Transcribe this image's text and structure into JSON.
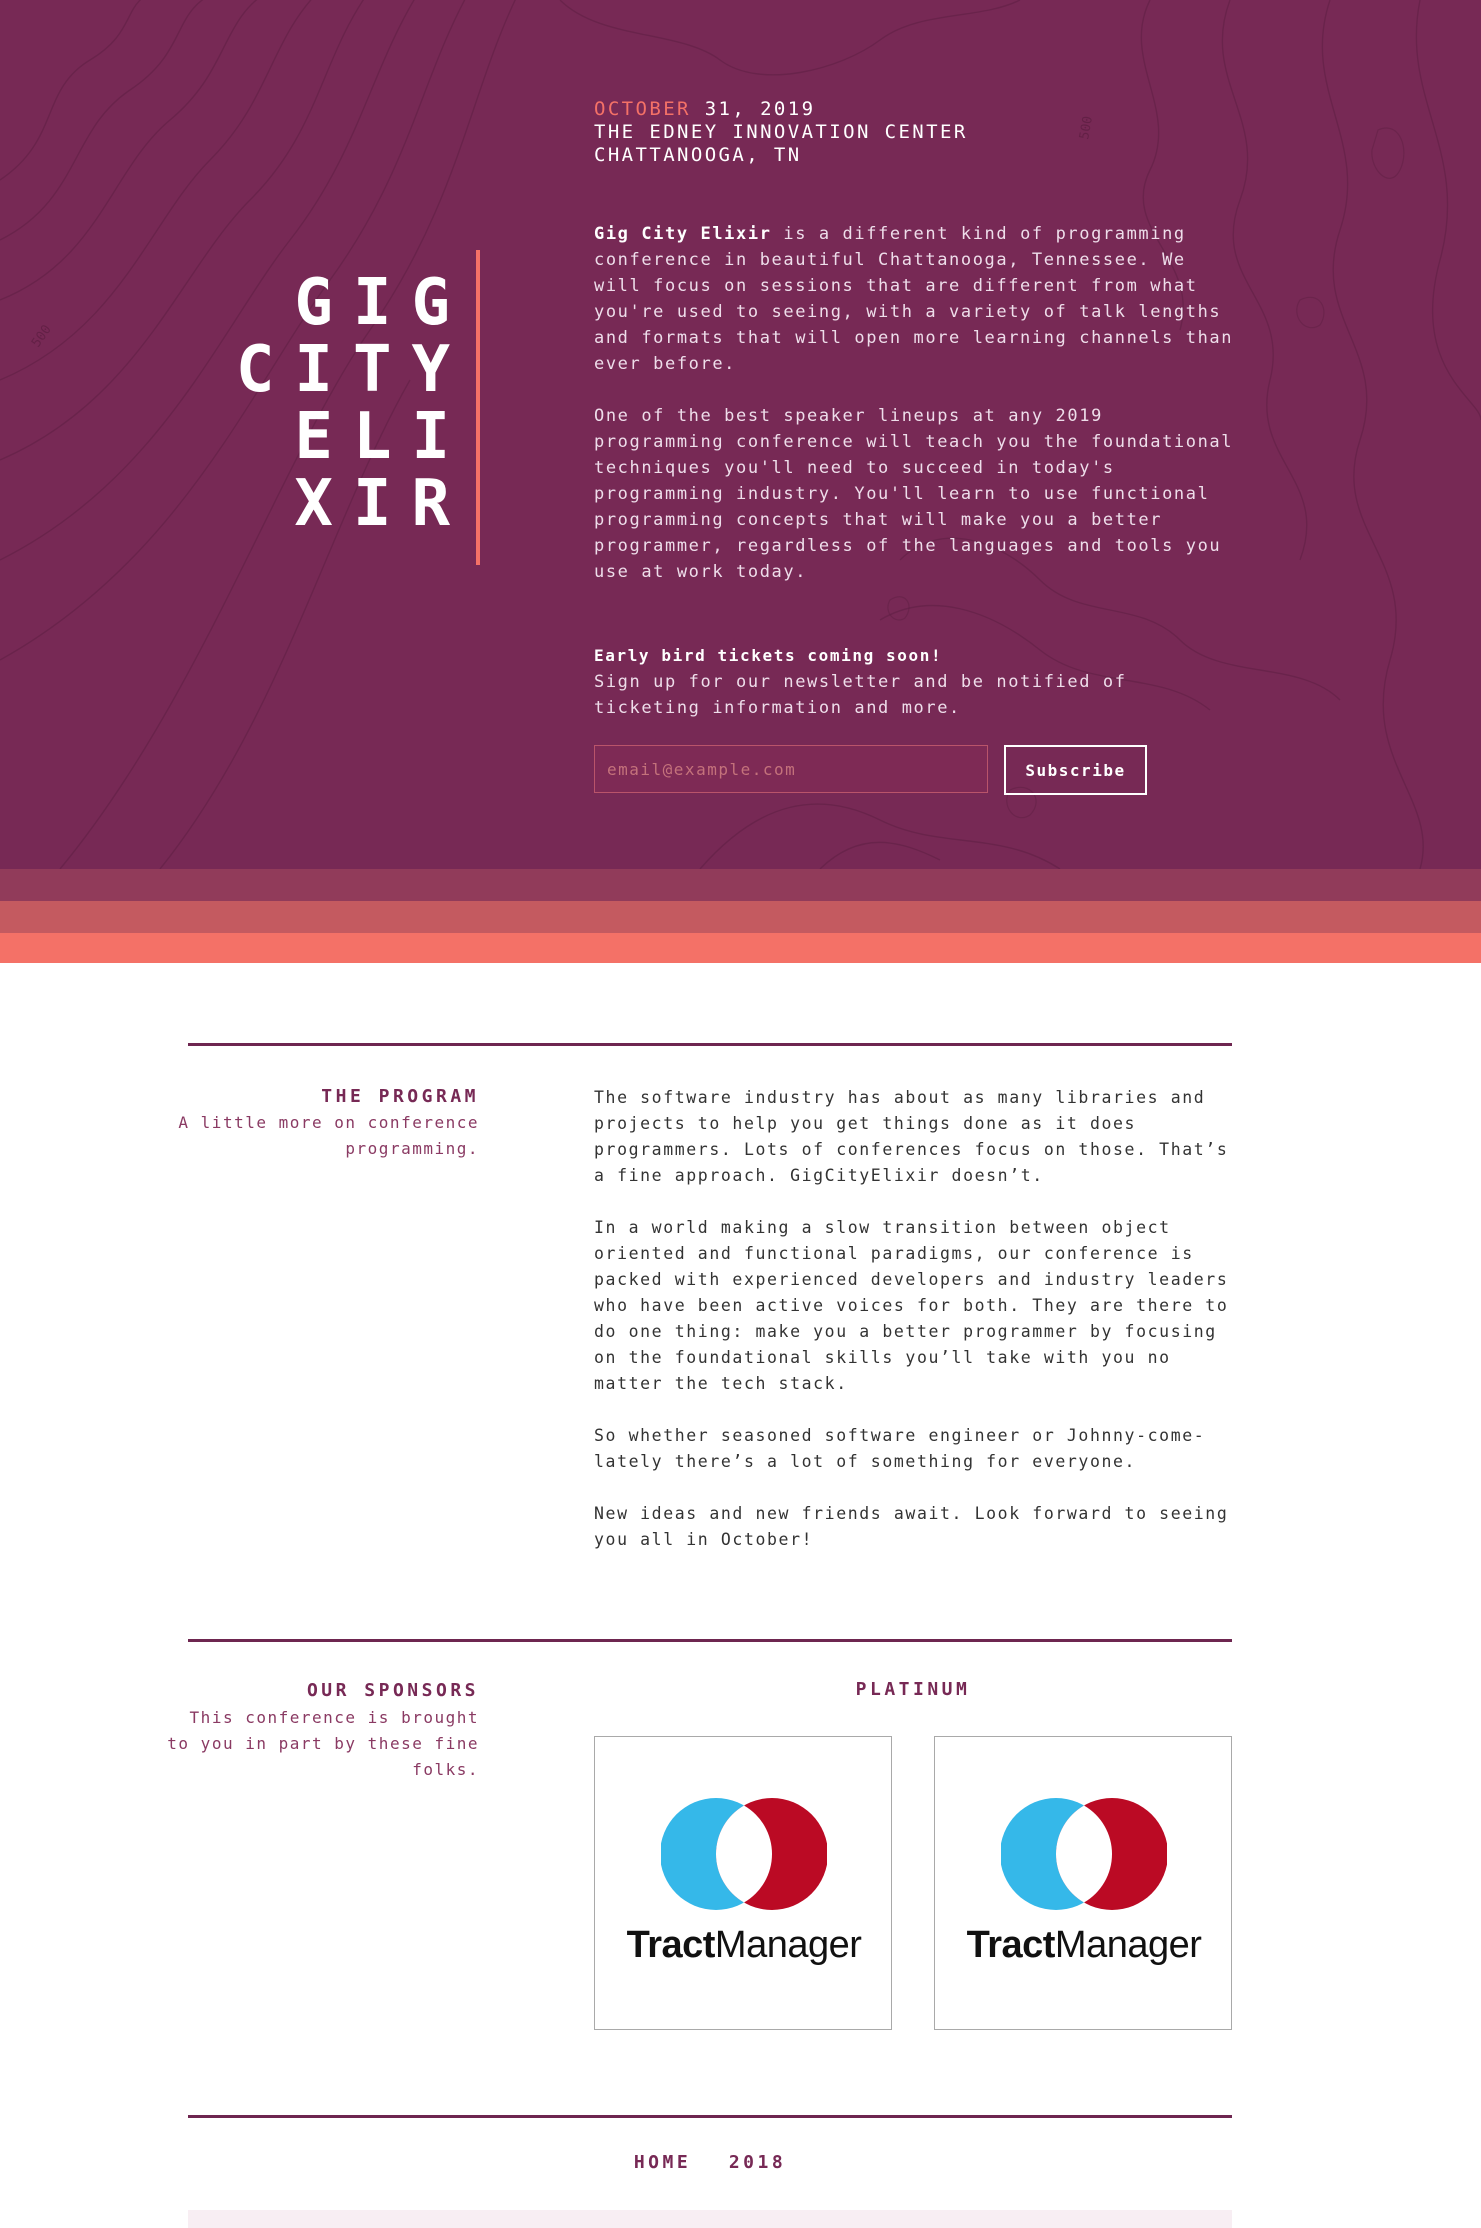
{
  "hero": {
    "logo_lines": [
      "GIG",
      "CITY",
      "ELI",
      "XIR"
    ],
    "date_month": "OCTOBER",
    "date_rest": " 31, 2019",
    "venue_line1": "THE EDNEY INNOVATION CENTER",
    "venue_line2": "CHATTANOOGA, TN",
    "intro_name": "Gig City Elixir",
    "intro_rest": " is a different kind of programming conference in beautiful Chattanooga, Tennessee. We will focus on sessions that are different from what you're used to seeing, with a variety of talk lengths and formats that will open more learning channels than ever before.",
    "para2": "One of the best speaker lineups at any 2019 programming conference will teach you the foundational techniques you'll need to succeed in today's programming industry. You'll learn to use functional programming concepts that will make you a better programmer, regardless of the languages and tools you use at work today.",
    "early_bird": "Early bird tickets coming soon!",
    "signup_text": "Sign up for our newsletter and be notified of ticketing information and more.",
    "email_placeholder": "email@example.com",
    "subscribe_label": "Subscribe",
    "contour_labels": [
      "500",
      "500"
    ]
  },
  "program": {
    "title": "THE PROGRAM",
    "subtitle": "A little more on conference programming.",
    "paragraphs": [
      "The software industry has about as many libraries and projects to help you get things done as it does programmers. Lots of conferences focus on those. That’s a fine approach. GigCityElixir doesn’t.",
      "In a world making a slow transition between object oriented and functional paradigms, our conference is packed with experienced developers and industry leaders who have been active voices for both. They are there to do one thing: make you a better programmer by focusing on the foundational skills you’ll take with you no matter the tech stack.",
      "So whether seasoned software engineer or Johnny-come-lately there’s a lot of something for everyone.",
      "New ideas and new friends await. Look forward to seeing you all in October!"
    ]
  },
  "sponsors": {
    "title": "OUR SPONSORS",
    "subtitle": "This conference is brought to you in part by these fine folks.",
    "tier": "PLATINUM",
    "items": [
      {
        "name_bold": "Tract",
        "name_regular": "Manager"
      },
      {
        "name_bold": "Tract",
        "name_regular": "Manager"
      }
    ],
    "colors": {
      "blue": "#35b8e9",
      "red": "#bb0a24"
    }
  },
  "footer": {
    "links": [
      "HOME",
      "2018"
    ]
  },
  "colors": {
    "primary": "#772955",
    "accent": "#f47167",
    "stripe1": "#913b5a",
    "stripe2": "#c45a60"
  }
}
